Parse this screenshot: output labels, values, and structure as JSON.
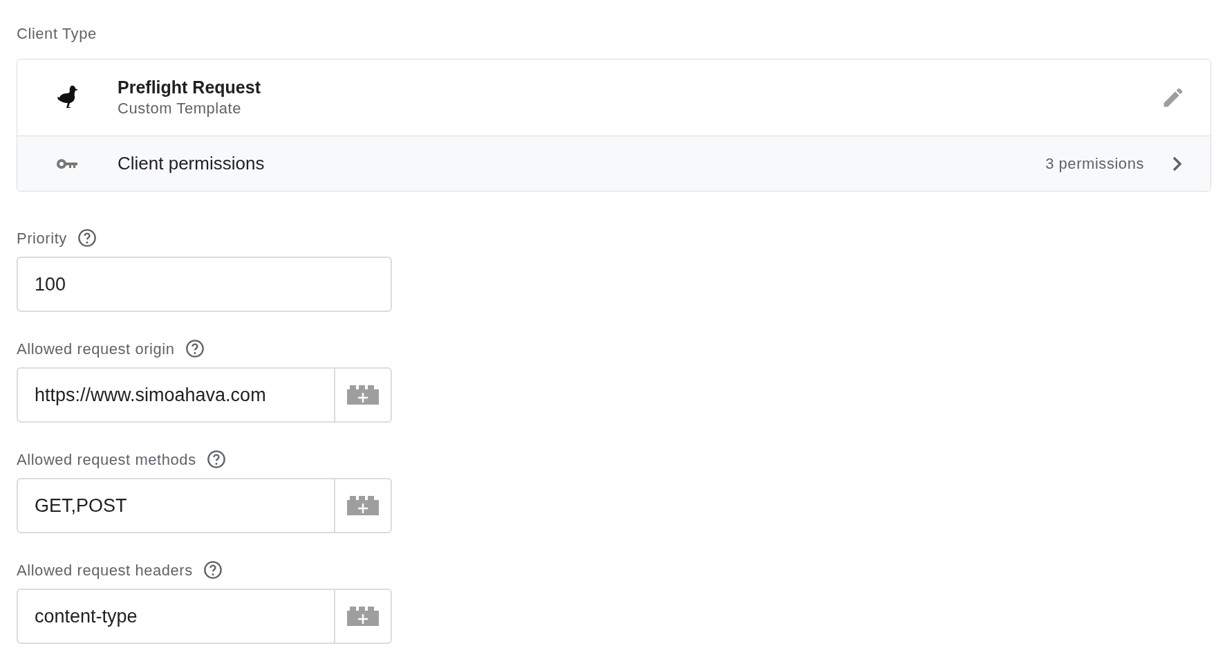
{
  "section_label": "Client Type",
  "client": {
    "name": "Preflight Request",
    "subtitle": "Custom Template",
    "permissions_label": "Client permissions",
    "permissions_count": "3 permissions"
  },
  "fields": [
    {
      "label": "Priority",
      "value": "100",
      "kind": "plain"
    },
    {
      "label": "Allowed request origin",
      "value": "https://www.simoahava.com",
      "kind": "variable"
    },
    {
      "label": "Allowed request methods",
      "value": "GET,POST",
      "kind": "variable"
    },
    {
      "label": "Allowed request headers",
      "value": "content-type",
      "kind": "variable"
    }
  ]
}
